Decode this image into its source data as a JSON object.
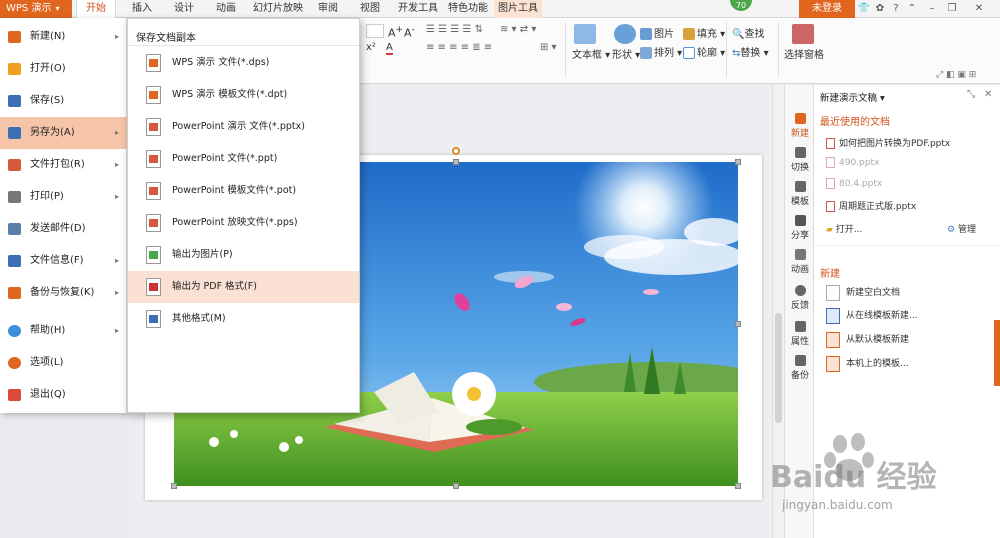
{
  "app_menu": {
    "label": "WPS 演示"
  },
  "tabs": [
    "开始",
    "插入",
    "设计",
    "动画",
    "幻灯片放映",
    "审阅",
    "视图",
    "开发工具",
    "特色功能",
    "图片工具"
  ],
  "badge": "70",
  "login": "未登录",
  "ribbon": {
    "text_box": "文本框",
    "shape": "形状",
    "picture": "图片",
    "arrange": "排列",
    "fill": "填充",
    "outline": "轮廓",
    "find": "查找",
    "replace": "替换",
    "selection_pane": "选择窗格"
  },
  "left_menu": {
    "items": [
      {
        "label": "新建(N)",
        "arrow": "▸"
      },
      {
        "label": "打开(O)",
        "arrow": ""
      },
      {
        "label": "保存(S)",
        "arrow": ""
      },
      {
        "label": "另存为(A)",
        "arrow": "▸"
      },
      {
        "label": "文件打包(R)",
        "arrow": "▸"
      },
      {
        "label": "打印(P)",
        "arrow": "▸"
      },
      {
        "label": "发送邮件(D)",
        "arrow": ""
      },
      {
        "label": "文件信息(F)",
        "arrow": "▸"
      },
      {
        "label": "备份与恢复(K)",
        "arrow": "▸"
      },
      {
        "label": "帮助(H)",
        "arrow": "▸"
      },
      {
        "label": "选项(L)",
        "arrow": ""
      },
      {
        "label": "退出(Q)",
        "arrow": ""
      }
    ]
  },
  "sub_menu": {
    "title": "保存文档副本",
    "items": [
      "WPS 演示 文件(*.dps)",
      "WPS 演示 模板文件(*.dpt)",
      "PowerPoint 演示 文件(*.pptx)",
      "PowerPoint 文件(*.ppt)",
      "PowerPoint 模板文件(*.pot)",
      "PowerPoint 放映文件(*.pps)",
      "输出为图片(P)",
      "输出为 PDF 格式(F)",
      "其他格式(M)"
    ]
  },
  "side_bar": [
    "新建",
    "切换",
    "模板",
    "分享",
    "动画",
    "反馈",
    "属性",
    "备份"
  ],
  "task_pane": {
    "title": "新建演示文稿",
    "recent_heading": "最近使用的文档",
    "recent_files": [
      {
        "name": "如何把图片转换为PDF.pptx",
        "dim": false
      },
      {
        "name": "490.pptx",
        "dim": true
      },
      {
        "name": "80.4.pptx",
        "dim": true
      },
      {
        "name": "周期题正式版.pptx",
        "dim": false
      }
    ],
    "open": "打开...",
    "manage": "管理",
    "new_heading": "新建",
    "new_items": [
      "新建空白文档",
      "从在线模板新建...",
      "从默认模板新建",
      "本机上的模板..."
    ]
  },
  "watermark": {
    "brand": "Baidu 经验",
    "url": "jingyan.baidu.com"
  },
  "colors": {
    "accent": "#e0651f",
    "menu_hover": "#f6c5a9",
    "sub_hover": "#fbe1d3",
    "link_orange": "#d2531a"
  }
}
